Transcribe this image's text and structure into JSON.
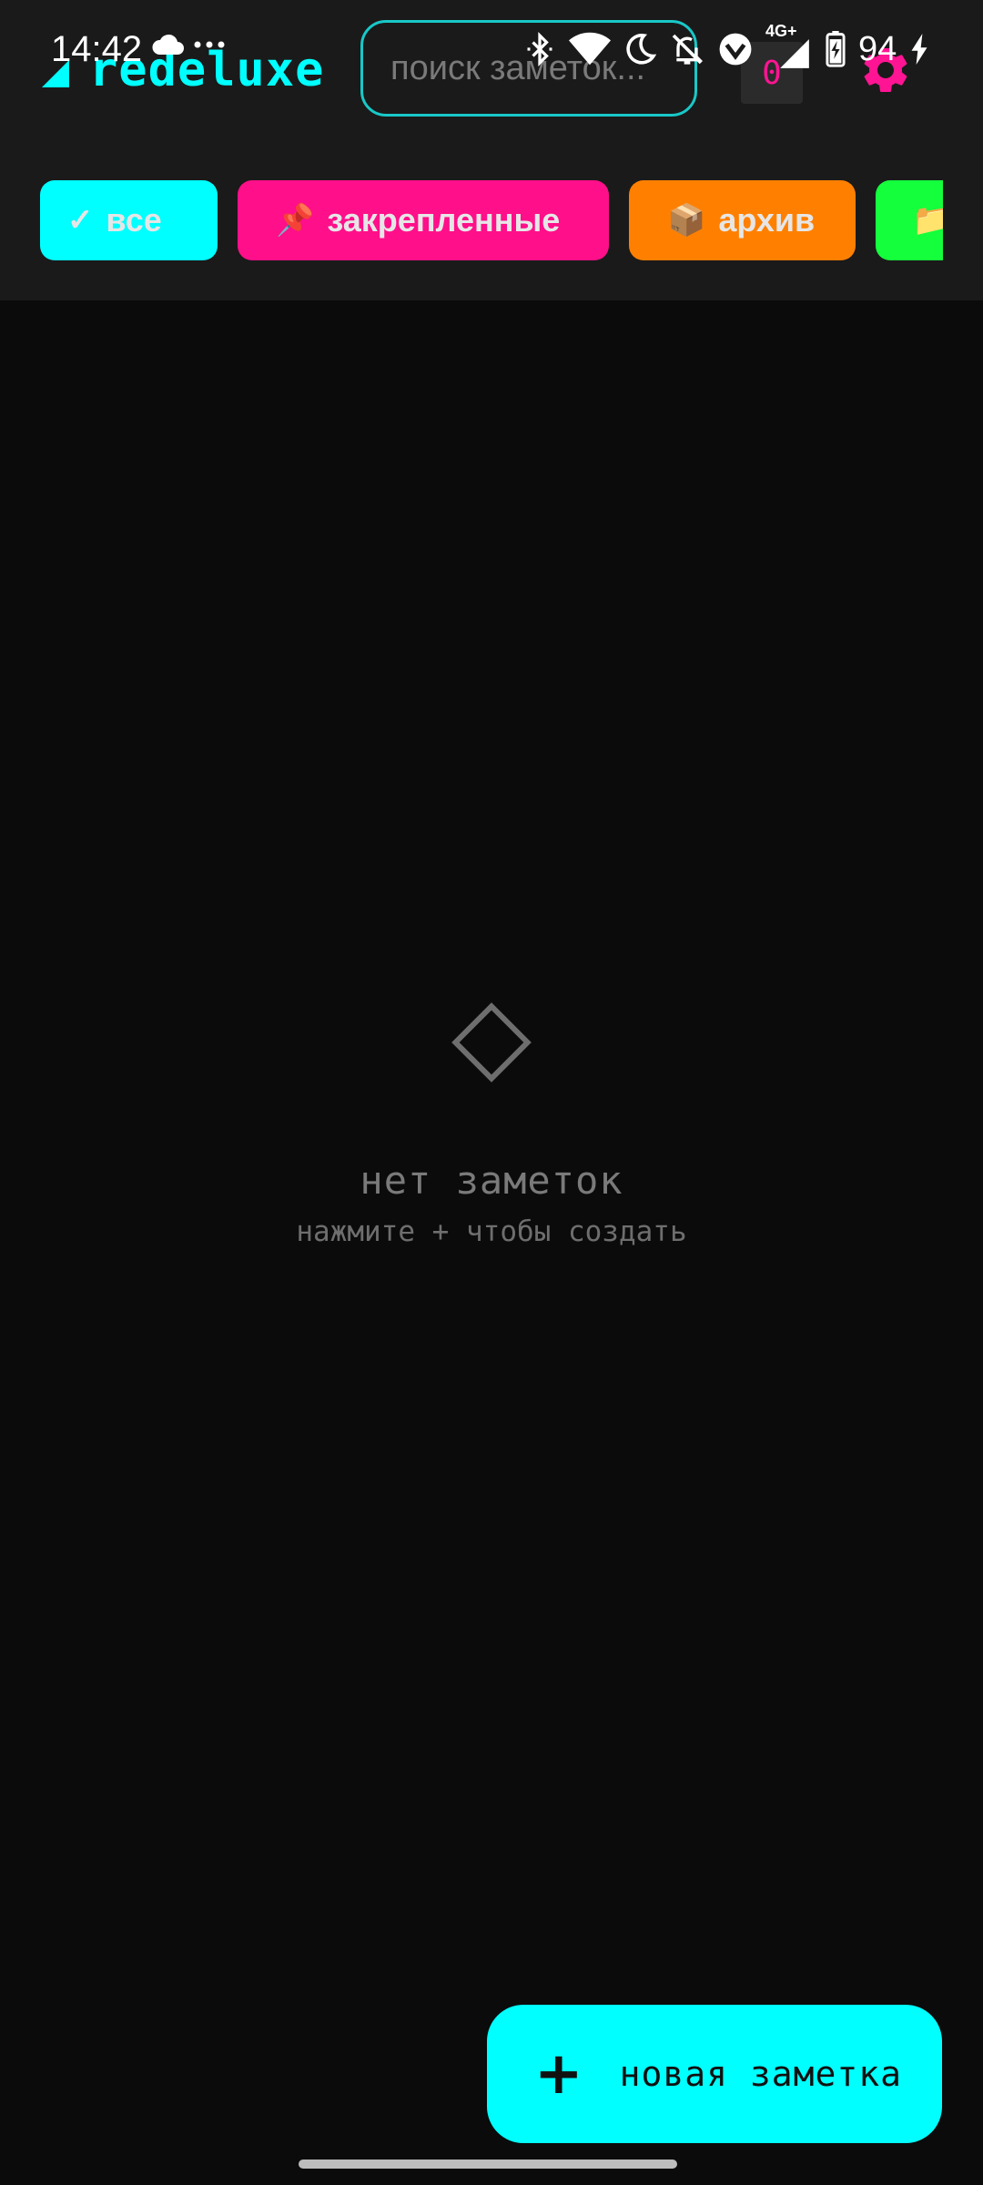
{
  "status_bar": {
    "time": "14:42",
    "battery_level": "94",
    "network_label": "4G+",
    "left_icons": [
      "cloud-icon",
      "more-dots-icon"
    ],
    "right_icons": [
      "bluetooth-icon",
      "wifi-icon",
      "do-not-disturb-moon-icon",
      "bell-off-icon",
      "vpn-check-icon",
      "signal-icon",
      "battery-icon",
      "charging-bolt-icon"
    ]
  },
  "app_bar": {
    "brand_name": "redeluxe",
    "search": {
      "placeholder": "поиск заметок...",
      "value": ""
    },
    "counter": "0",
    "settings_icon": "gear-icon",
    "colors": {
      "background": "#1a1a1a",
      "accent": "#00ffff",
      "counter_text": "#ff1493",
      "settings_icon": "#ff1493"
    }
  },
  "filters": [
    {
      "label": "все",
      "icon": "check-icon",
      "icon_glyph": "✓",
      "color": "#00ffff",
      "selected": true
    },
    {
      "label": "закрепленные",
      "icon": "pin-icon",
      "icon_glyph": "📌",
      "color": "#ff0f8a",
      "selected": false
    },
    {
      "label": "архив",
      "icon": "package-icon",
      "icon_glyph": "📦",
      "color": "#ff8000",
      "selected": false
    },
    {
      "label": "",
      "icon": "folder-icon",
      "icon_glyph": "📁",
      "color": "#14ff3c",
      "selected": false
    }
  ],
  "empty_state": {
    "icon": "diamond-outline-icon",
    "title": "нет заметок",
    "subtitle": "нажмите + чтобы создать"
  },
  "fab": {
    "icon": "plus-icon",
    "icon_glyph": "+",
    "label": "новая заметка",
    "color": "#00ffff"
  }
}
